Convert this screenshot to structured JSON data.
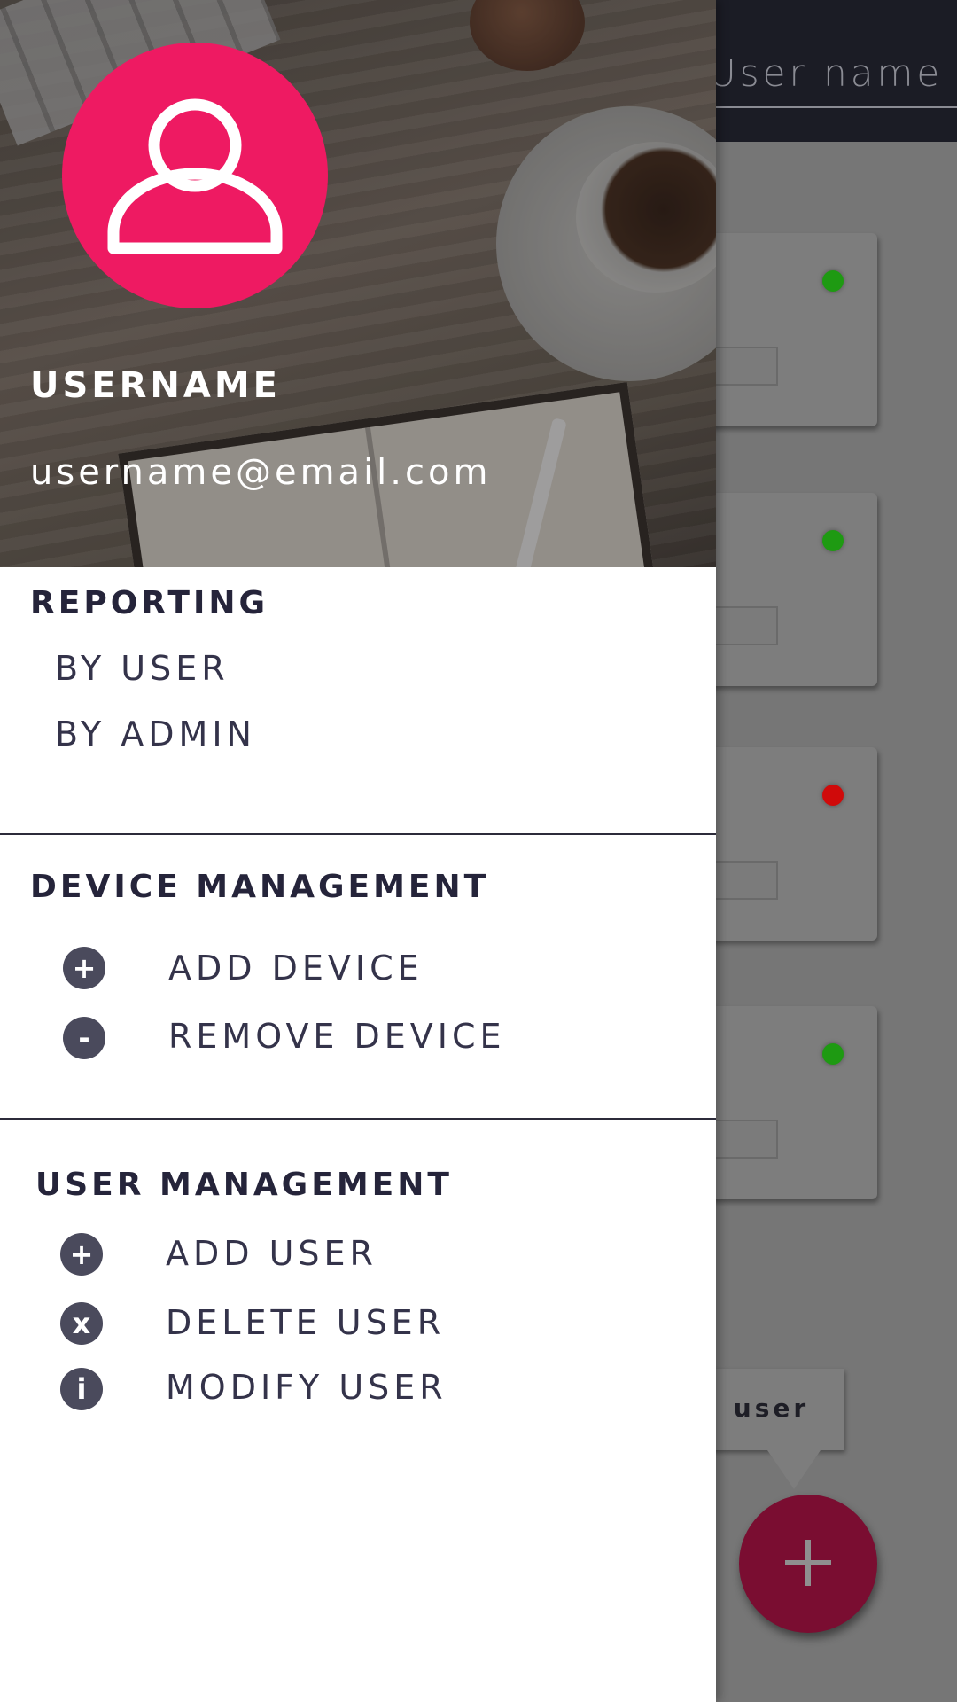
{
  "app_header": {
    "username_placeholder": "User name"
  },
  "device_cards": [
    {
      "status_color": "#1e9a12"
    },
    {
      "status_color": "#1e9a12"
    },
    {
      "status_color": "#d00a0a"
    },
    {
      "status_color": "#1e9a12"
    }
  ],
  "tooltip": {
    "label": "d user"
  },
  "fab": {
    "icon": "plus-icon"
  },
  "drawer": {
    "header": {
      "username": "USERNAME",
      "email": "username@email.com",
      "avatar_icon": "user-icon",
      "avatar_color": "#ee1a62"
    },
    "sections": {
      "reporting": {
        "title": "REPORTING",
        "items": [
          "BY USER",
          "BY ADMIN"
        ]
      },
      "device_management": {
        "title": "DEVICE MANAGEMENT",
        "items": [
          {
            "icon": "plus-circle-icon",
            "label": "ADD DEVICE"
          },
          {
            "icon": "minus-circle-icon",
            "label": "REMOVE DEVICE"
          }
        ]
      },
      "user_management": {
        "title": "USER MANAGEMENT",
        "items": [
          {
            "icon": "plus-circle-icon",
            "label": "ADD USER"
          },
          {
            "icon": "x-circle-icon",
            "label": "DELETE USER"
          },
          {
            "icon": "info-circle-icon",
            "label": "MODIFY USER"
          }
        ]
      }
    }
  },
  "colors": {
    "accent": "#ee1a62",
    "text_dark": "#25243a",
    "icon_bg": "#4a4a5c",
    "header_bg": "#1b1c25"
  }
}
